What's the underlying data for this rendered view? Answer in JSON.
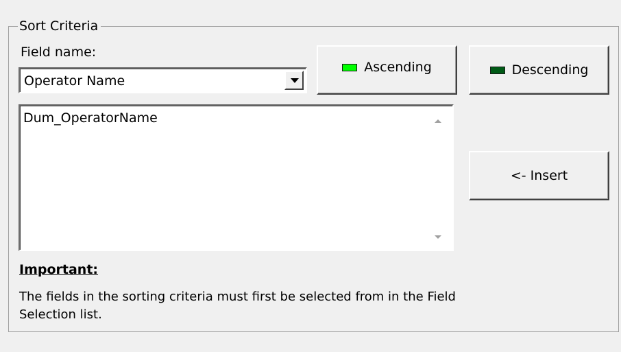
{
  "group": {
    "title": "Sort Criteria"
  },
  "field": {
    "label": "Field name:",
    "selected_value": "Operator Name"
  },
  "buttons": {
    "ascending_label": "Ascending",
    "descending_label": "Descending",
    "insert_label": "<- Insert"
  },
  "colors": {
    "ascending_indicator": "#00ff00",
    "descending_indicator": "#005a16"
  },
  "criteria_list": {
    "items": [
      "Dum_OperatorName"
    ]
  },
  "note": {
    "heading": "Important:",
    "text": "The fields in the sorting criteria must first be selected from in the Field Selection list."
  }
}
